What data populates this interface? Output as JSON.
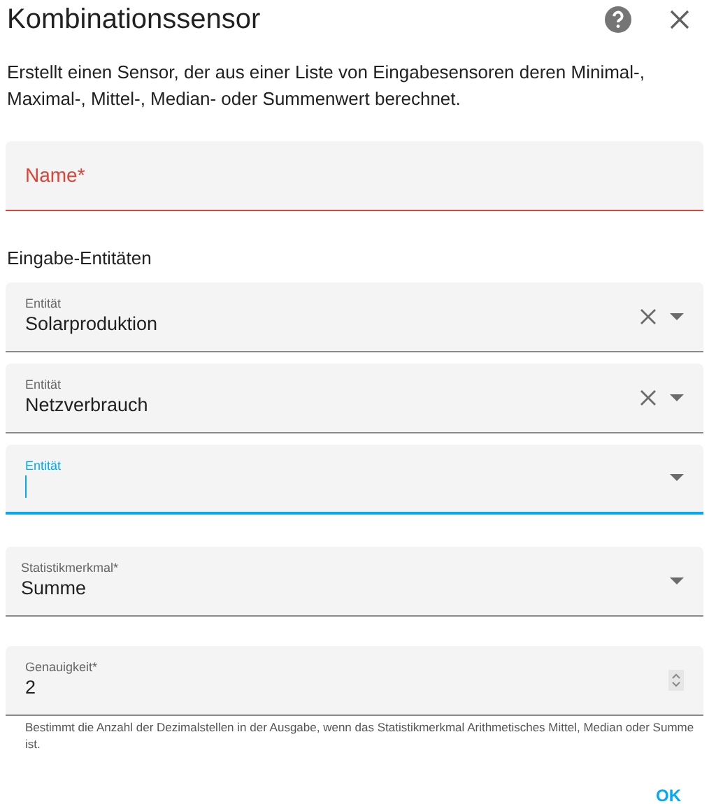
{
  "dialog": {
    "title": "Kombinationssensor",
    "description": "Erstellt einen Sensor, der aus einer Liste von Eingabesensoren deren Minimal-, Maximal-, Mittel-, Median- oder Summenwert berechnet."
  },
  "name_field": {
    "label": "Name*",
    "invalid": true
  },
  "section_label": "Eingabe-Entitäten",
  "entities": [
    {
      "label": "Entität",
      "value": "Solarproduktion",
      "focused": false
    },
    {
      "label": "Entität",
      "value": "Netzverbrauch",
      "focused": false
    },
    {
      "label": "Entität",
      "focused": true
    }
  ],
  "statistic": {
    "label": "Statistikmerkmal*",
    "value": "Summe"
  },
  "precision": {
    "label": "Genauigkeit*",
    "value": "2",
    "helper": "Bestimmt die Anzahl der Dezimalstellen in der Ausgabe, wenn das Statistikmerkmal Arithmetisches Mittel, Median oder Summe ist."
  },
  "buttons": [
    {
      "label": "OK"
    }
  ]
}
